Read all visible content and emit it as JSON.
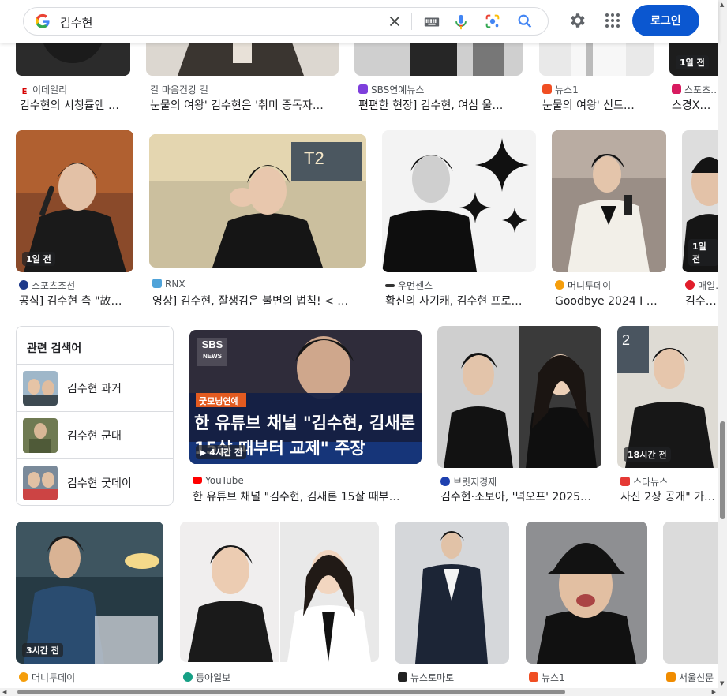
{
  "search": {
    "query": "김수현"
  },
  "header": {
    "login_label": "로그인"
  },
  "colors": {
    "accent": "#0b57d0",
    "link": "#202124",
    "source": "#4d5156"
  },
  "icons": [
    "google-logo",
    "clear-icon",
    "keyboard-icon",
    "mic-icon",
    "lens-icon",
    "search-icon",
    "gear-icon",
    "apps-icon"
  ],
  "row0": [
    {
      "source": "이데일리",
      "title": "김수현의 시청률엔 …"
    },
    {
      "source": "길 마음건강 길",
      "title": "눈물의 여왕' 김수현은 '취미 중독자…"
    },
    {
      "source": "SBS연예뉴스",
      "title": "편편한 현장] 김수현, 여심 울…"
    },
    {
      "source": "뉴스1",
      "title": "눈물의 여왕' 신드…"
    },
    {
      "source": "스포츠…",
      "title": "스경X이…",
      "badge": "1일 전"
    }
  ],
  "row1": [
    {
      "source": "스포츠조선",
      "title": "공식] 김수현 측 \"故…",
      "badge": "1일 전"
    },
    {
      "source": "RNX",
      "title": "영상] 김수현, 잘생김은 불변의 법칙! < …"
    },
    {
      "source": "우먼센스",
      "title": "확신의 사기캐, 김수현 프로…"
    },
    {
      "source": "머니투데이",
      "title": "Goodbye 2024 I 용…"
    },
    {
      "source": "매일…",
      "title": "김수현…",
      "badge": "1일 전"
    }
  ],
  "related": {
    "title": "관련 검색어",
    "items": [
      {
        "label": "김수현 과거"
      },
      {
        "label": "김수현 군대"
      },
      {
        "label": "김수현 굿데이"
      }
    ]
  },
  "row2": [
    {
      "source": "YouTube",
      "title": "한 유튜브 채널 \"김수현, 김새론 15살 때부…",
      "badge": "4시간 전",
      "overlay": {
        "logo_top": "SBS",
        "logo_bottom": "NEWS",
        "tag": "굿모닝연예",
        "line1": "한 유튜브 채널 \"김수현, 김새론",
        "line2": "15살 때부터 교제\" 주장"
      }
    },
    {
      "source": "브릿지경제",
      "title": "김수현·조보아, '넉오프' 2025…"
    },
    {
      "source": "스타뉴스",
      "title": "사진 2장 공개\" 가…",
      "badge": "18시간 전"
    }
  ],
  "row3": [
    {
      "source": "머니투데이",
      "badge": "3시간 전"
    },
    {
      "source": "동아일보"
    },
    {
      "source": "뉴스토마토"
    },
    {
      "source": "뉴스1"
    },
    {
      "source": "서울신문"
    }
  ]
}
